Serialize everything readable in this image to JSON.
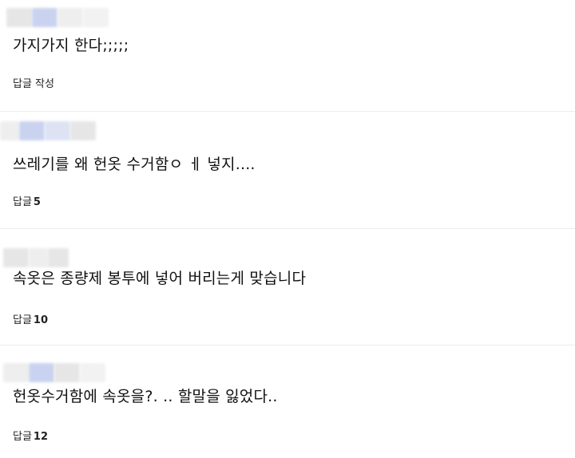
{
  "comments": [
    {
      "text": "가지가지 한다;;;;;",
      "reply_label": "답글 작성",
      "reply_count": ""
    },
    {
      "text": "쓰레기를 왜 헌옷 수거함ㅇ ㅔ 넣지....",
      "reply_label": "답글",
      "reply_count": "5"
    },
    {
      "text": "속옷은 종량제 봉투에 넣어 버리는게 맞습니다",
      "reply_label": "답글",
      "reply_count": "10"
    },
    {
      "text": "헌옷수거함에 속옷을?. .. 할말을 잃었다..",
      "reply_label": "답글",
      "reply_count": "12"
    }
  ]
}
